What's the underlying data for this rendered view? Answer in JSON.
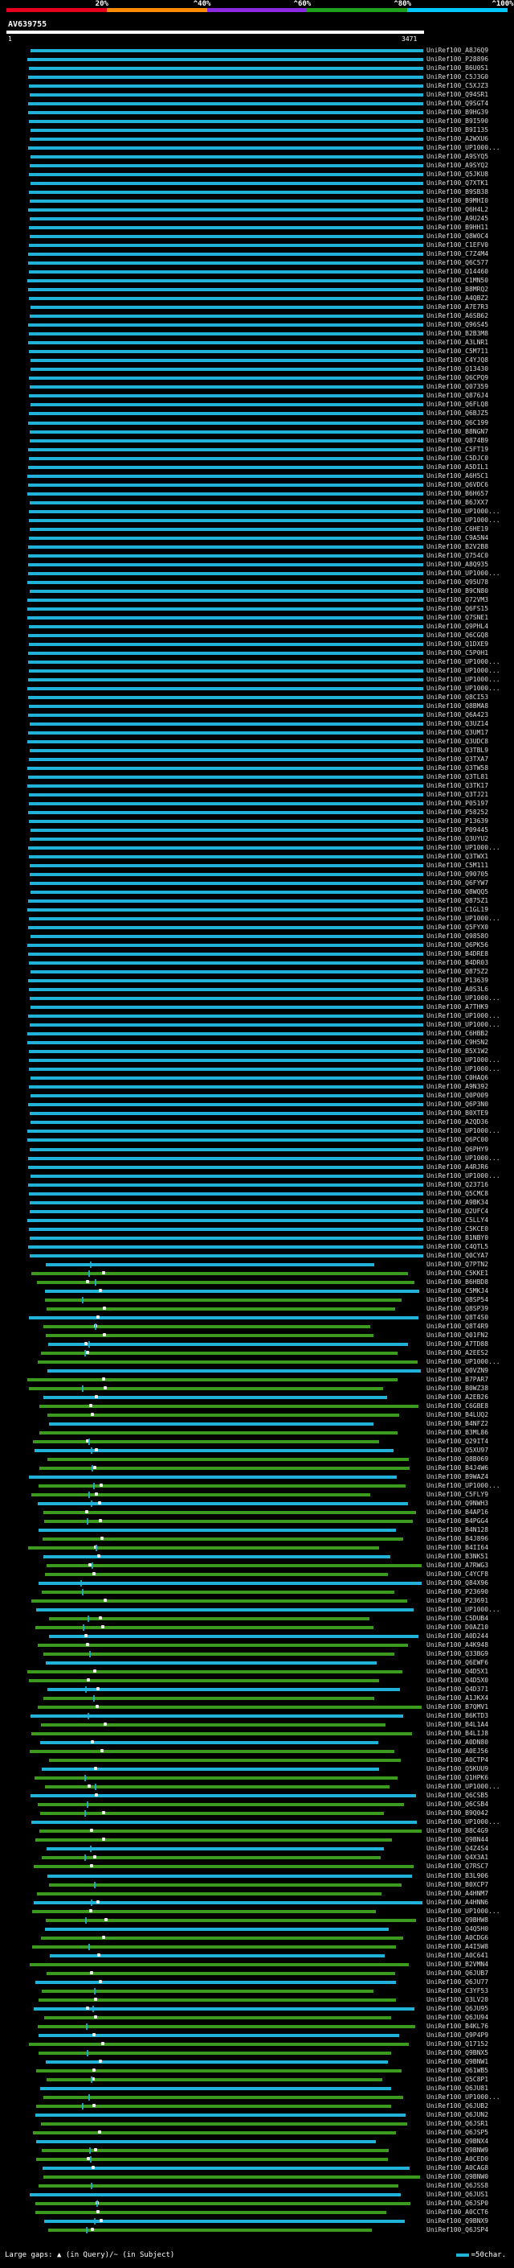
{
  "legend": {
    "segments": [
      {
        "color": "#e6001e"
      },
      {
        "color": "#ff8c00"
      },
      {
        "color": "#8a2be2"
      },
      {
        "color": "#1ea01e"
      },
      {
        "color": "#00c8ff"
      }
    ],
    "ticks": [
      "20%",
      "^40%",
      "^60%",
      "^80%",
      "^100%"
    ]
  },
  "query": {
    "id": "AV639755",
    "start": "1",
    "end": "3471"
  },
  "hits": [
    "UniRef100_A8J6Q9",
    "UniRef100_P28896",
    "UniRef100_B6U0S1",
    "UniRef100_C5J3G0",
    "UniRef100_C5XJZ3",
    "UniRef100_Q94SR1",
    "UniRef100_Q9SGT4",
    "UniRef100_B9HG39",
    "UniRef100_B9I590",
    "UniRef100_B9I135",
    "UniRef100_A2WXU6",
    "UniRef100_UP1000...",
    "UniRef100_A9SYQ5",
    "UniRef100_A9SYQ2",
    "UniRef100_Q5JKU8",
    "UniRef100_Q7XTK1",
    "UniRef100_B9SB38",
    "UniRef100_B9MHI0",
    "UniRef100_Q6H4L2",
    "UniRef100_A9U245",
    "UniRef100_B9HH11",
    "UniRef100_Q8W0C4",
    "UniRef100_C1EFV0",
    "UniRef100_C7Z4M4",
    "UniRef100_Q6C577",
    "UniRef100_Q14460",
    "UniRef100_C1MN50",
    "UniRef100_B8MRQ2",
    "UniRef100_A4QBZ2",
    "UniRef100_A7E7R3",
    "UniRef100_A6SB62",
    "UniRef100_Q96S45",
    "UniRef100_B2B3M8",
    "UniRef100_A3LNR1",
    "UniRef100_C5M711",
    "UniRef100_C4YJQ8",
    "UniRef100_Q13430",
    "UniRef100_Q6CPQ9",
    "UniRef100_Q07359",
    "UniRef100_Q876J4",
    "UniRef100_Q6FLQ8",
    "UniRef100_Q6BJZ5",
    "UniRef100_Q6C199",
    "UniRef100_B8NGN7",
    "UniRef100_Q874B9",
    "UniRef100_C5FT19",
    "UniRef100_C5DJC0",
    "UniRef100_A5DIL1",
    "UniRef100_A6H5C1",
    "UniRef100_Q6VDC6",
    "UniRef100_B6H657",
    "UniRef100_B6JXX7",
    "UniRef100_UP1000...",
    "UniRef100_UP1000...",
    "UniRef100_C6HE19",
    "UniRef100_C9A5N4",
    "UniRef100_B2V2B8",
    "UniRef100_Q754C0",
    "UniRef100_A8Q935",
    "UniRef100_UP1000...",
    "UniRef100_Q95U78",
    "UniRef100_B9CN80",
    "UniRef100_Q72VM3",
    "UniRef100_Q6FS15",
    "UniRef100_Q7SNE1",
    "UniRef100_Q9PHL4",
    "UniRef100_Q6CGQ8",
    "UniRef100_Q1DXE9",
    "UniRef100_C5P0H1",
    "UniRef100_UP1000...",
    "UniRef100_UP1000...",
    "UniRef100_UP1000...",
    "UniRef100_UP1000...",
    "UniRef100_Q8CI53",
    "UniRef100_Q8BMA8",
    "UniRef100_Q6A423",
    "UniRef100_Q3UZ14",
    "UniRef100_Q3UM17",
    "UniRef100_Q3UDC8",
    "UniRef100_Q3TBL9",
    "UniRef100_Q3TXA7",
    "UniRef100_Q3TW58",
    "UniRef100_Q3TL81",
    "UniRef100_Q3TK17",
    "UniRef100_Q3TJ21",
    "UniRef100_P05197",
    "UniRef100_P58252",
    "UniRef100_P13639",
    "UniRef100_P09445",
    "UniRef100_Q3UYU2",
    "UniRef100_UP1000...",
    "UniRef100_Q3TWX1",
    "UniRef100_C5M111",
    "UniRef100_Q90705",
    "UniRef100_Q6FYW7",
    "UniRef100_Q8WQQ5",
    "UniRef100_Q875Z1",
    "UniRef100_C1GL19",
    "UniRef100_UP1000...",
    "UniRef100_Q5FYX0",
    "UniRef100_Q9858O",
    "UniRef100_Q6PK56",
    "UniRef100_B4DRE8",
    "UniRef100_B4DR03",
    "UniRef100_Q875Z2",
    "UniRef100_P13639",
    "UniRef100_A0S3L6",
    "UniRef100_UP1000...",
    "UniRef100_A7THK9",
    "UniRef100_UP1000...",
    "UniRef100_UP1000...",
    "UniRef100_C6HBB2",
    "UniRef100_C9H5N2",
    "UniRef100_B5X1W2",
    "UniRef100_UP1000...",
    "UniRef100_UP1000...",
    "UniRef100_C0HAQ6",
    "UniRef100_A9N392",
    "UniRef100_Q0P009",
    "UniRef100_Q6P3N0",
    "UniRef100_B0XTE9",
    "UniRef100_A2QD36",
    "UniRef100_UP1000...",
    "UniRef100_Q6PC00",
    "UniRef100_Q6PHY9",
    "UniRef100_UP1000...",
    "UniRef100_A4RJR6",
    "UniRef100_UP1000...",
    "UniRef100_Q23716",
    "UniRef100_Q5CMC8",
    "UniRef100_A9BK34",
    "UniRef100_Q2UFC4",
    "UniRef100_C5LLY4",
    "UniRef100_C5KCE0",
    "UniRef100_B1NBY0",
    "UniRef100_C4QTL5",
    "UniRef100_Q0CYA7",
    "UniRef100_Q7PTN2",
    "UniRef100_C5KKE1",
    "UniRef100_B6HBD8",
    "UniRef100_C5MKJ4",
    "UniRef100_Q8SP54",
    "UniRef100_Q8SP39",
    "UniRef100_Q8T4S0",
    "UniRef100_Q8T4R9",
    "UniRef100_Q01FN2",
    "UniRef100_A7TD88",
    "UniRef100_A2EES2",
    "UniRef100_UP1000...",
    "UniRef100_Q0VZN9",
    "UniRef100_B7PAR7",
    "UniRef100_B0WZ38",
    "UniRef100_A2EB26",
    "UniRef100_C6GBE8",
    "UniRef100_B4LUQ2",
    "UniRef100_B4NFZ2",
    "UniRef100_B3ML86",
    "UniRef100_Q29IT4",
    "UniRef100_Q5XU97",
    "UniRef100_Q8B069",
    "UniRef100_B4J4W6",
    "UniRef100_B9WAZ4",
    "UniRef100_UP1000...",
    "UniRef100_C5FLY9",
    "UniRef100_Q9NWH3",
    "UniRef100_B4AP16",
    "UniRef100_B4PGG4",
    "UniRef100_B4N128",
    "UniRef100_B4J896",
    "UniRef100_B4II64",
    "UniRef100_B3NK51",
    "UniRef100_A7RWG3",
    "UniRef100_C4YCF8",
    "UniRef100_Q84X96",
    "UniRef100_P23690",
    "UniRef100_P23691",
    "UniRef100_UP1000...",
    "UniRef100_C5DUB4",
    "UniRef100_D0AZ10",
    "UniRef100_A0D244",
    "UniRef100_A4K948",
    "UniRef100_Q33BG9",
    "UniRef100_Q6EWF6",
    "UniRef100_Q4D5X1",
    "UniRef100_Q4D5X0",
    "UniRef100_Q4D371",
    "UniRef100_A1JKX4",
    "UniRef100_B7QMV1",
    "UniRef100_B6KTD3",
    "UniRef100_B4L1A4",
    "UniRef100_B4LIJ8",
    "UniRef100_A0DN80",
    "UniRef100_A0EJ56",
    "UniRef100_A0CTP4",
    "UniRef100_Q5KUU9",
    "UniRef100_Q1HPK6",
    "UniRef100_UP1000...",
    "UniRef100_Q6CSB5",
    "UniRef100_Q6CSB4",
    "UniRef100_B9Q042",
    "UniRef100_UP1000...",
    "UniRef100_B8C4G9",
    "UniRef100_Q9BN44",
    "UniRef100_Q4Z4S4",
    "UniRef100_Q4X3A1",
    "UniRef100_Q7RSC7",
    "UniRef100_B3L906",
    "UniRef100_B0XCP7",
    "UniRef100_A4HNM7",
    "UniRef100_A4HNN6",
    "UniRef100_UP1000...",
    "UniRef100_Q9BHW8",
    "UniRef100_Q4Q5H0",
    "UniRef100_A0CDG6",
    "UniRef100_A4I5W8",
    "UniRef100_A0C641",
    "UniRef100_B2VMN4",
    "UniRef100_Q6JUB7",
    "UniRef100_Q6JU77",
    "UniRef100_C3YF53",
    "UniRef100_Q3LV20",
    "UniRef100_Q6JU95",
    "UniRef100_Q6JU94",
    "UniRef100_B4KL76",
    "UniRef100_Q9P4P9",
    "UniRef100_Q17152",
    "UniRef100_Q9BNX5",
    "UniRef100_Q9BNW1",
    "UniRef100_Q61WB5",
    "UniRef100_Q5C8P1",
    "UniRef100_Q6JU81",
    "UniRef100_UP1000...",
    "UniRef100_Q6JUB2",
    "UniRef100_Q6JUN2",
    "UniRef100_Q6JSR1",
    "UniRef100_Q6JSP5",
    "UniRef100_Q9BNX4",
    "UniRef100_Q9BNW9",
    "UniRef100_A0CED0",
    "UniRef100_A0CAG8",
    "UniRef100_Q9BNW0",
    "UniRef100_Q6JSS8",
    "UniRef100_Q6JUS1",
    "UniRef100_Q6JSP0",
    "UniRef100_A0CCT6",
    "UniRef100_Q9BNX9",
    "UniRef100_Q6JSP4"
  ],
  "footer": {
    "large_gaps": "Large gaps:",
    "in_query": "(in Query)",
    "separator": "/~",
    "in_subject": "(in Subject)",
    "scale": "=50char."
  }
}
